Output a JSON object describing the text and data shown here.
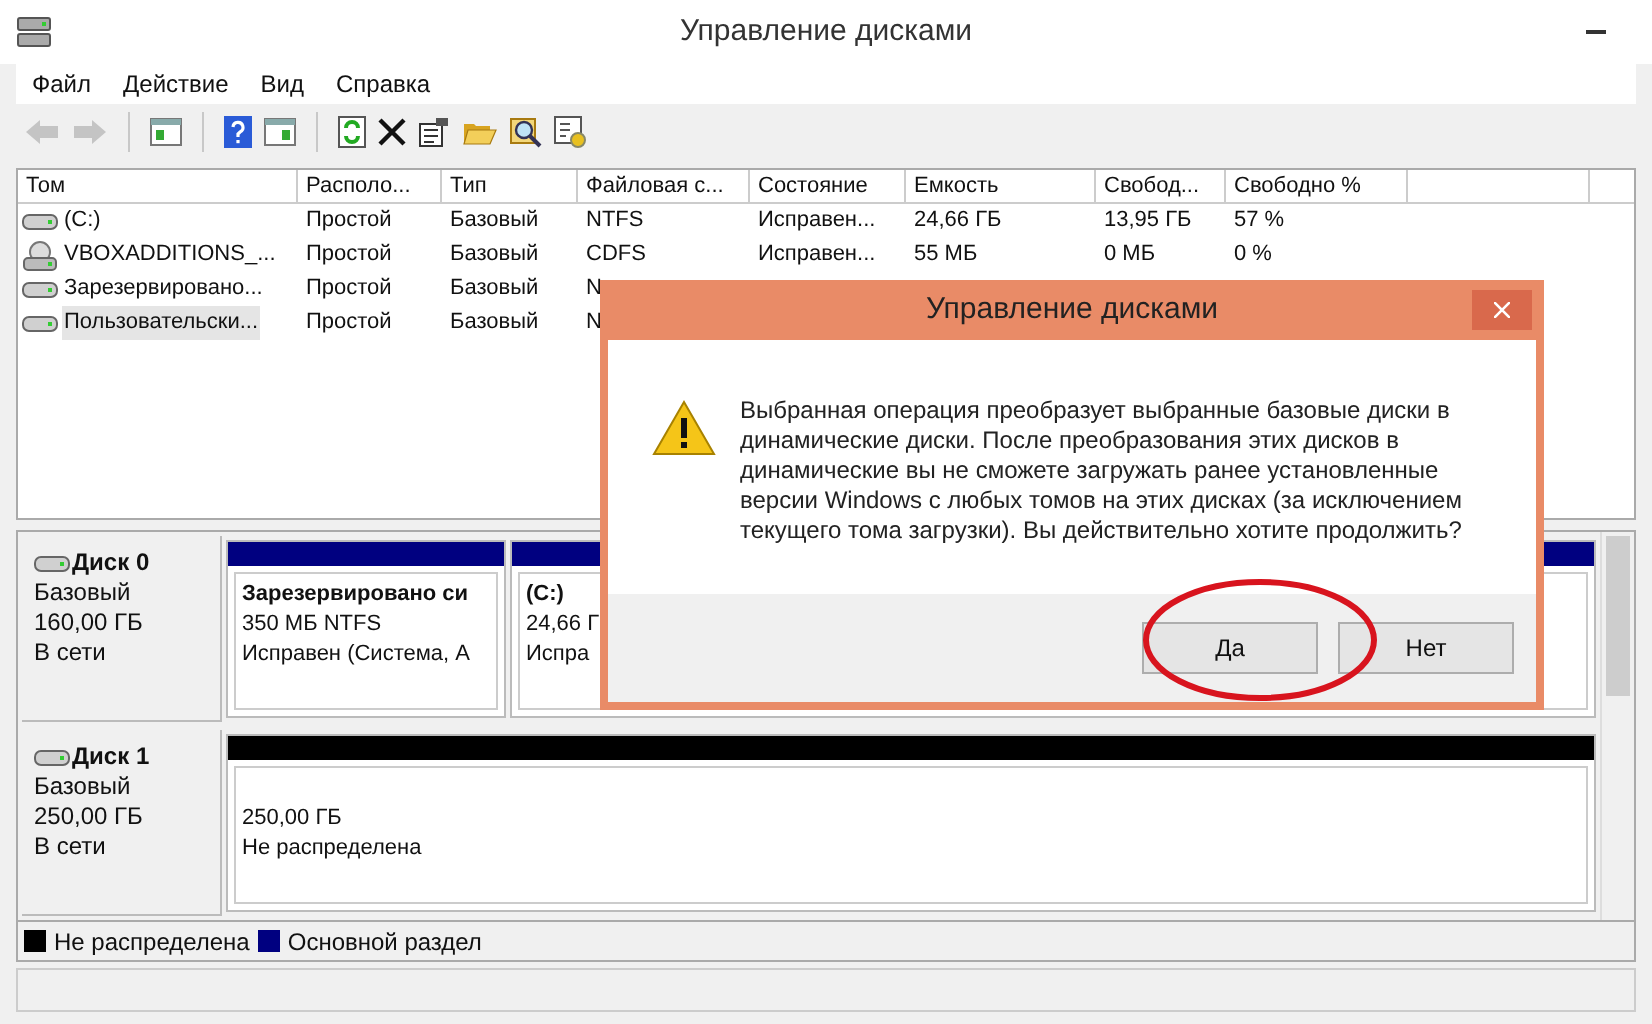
{
  "window": {
    "title": "Управление дисками"
  },
  "menu": [
    "Файл",
    "Действие",
    "Вид",
    "Справка"
  ],
  "toolbar": [
    {
      "kind": "back",
      "disabled": true
    },
    {
      "kind": "forward",
      "disabled": true
    },
    {
      "kind": "sep",
      "disabled": false
    },
    {
      "kind": "panel",
      "disabled": false
    },
    {
      "kind": "sep",
      "disabled": false
    },
    {
      "kind": "help",
      "disabled": false
    },
    {
      "kind": "panel2",
      "disabled": false
    },
    {
      "kind": "sep",
      "disabled": false
    },
    {
      "kind": "refresh",
      "disabled": false
    },
    {
      "kind": "delete",
      "disabled": false
    },
    {
      "kind": "props",
      "disabled": false
    },
    {
      "kind": "open",
      "disabled": false
    },
    {
      "kind": "search",
      "disabled": false
    },
    {
      "kind": "settings",
      "disabled": false
    }
  ],
  "volumes": {
    "columns": [
      "Том",
      "Располо...",
      "Тип",
      "Файловая с...",
      "Состояние",
      "Емкость",
      "Свобод...",
      "Свободно %"
    ],
    "rows": [
      {
        "kind": "drive",
        "selected": false,
        "cells": [
          "(C:)",
          "Простой",
          "Базовый",
          "NTFS",
          "Исправен...",
          "24,66 ГБ",
          "13,95 ГБ",
          "57 %"
        ]
      },
      {
        "kind": "cd",
        "selected": false,
        "cells": [
          "VBOXADDITIONS_...",
          "Простой",
          "Базовый",
          "CDFS",
          "Исправен...",
          "55 МБ",
          "0 МБ",
          "0 %"
        ]
      },
      {
        "kind": "drive",
        "selected": false,
        "cells": [
          "Зарезервировано...",
          "Простой",
          "Базовый",
          "N"
        ]
      },
      {
        "kind": "drive",
        "selected": true,
        "cells": [
          "Пользовательски...",
          "Простой",
          "Базовый",
          "N"
        ]
      }
    ]
  },
  "disks": [
    {
      "name": "Диск 0",
      "type": "Базовый",
      "size": "160,00 ГБ",
      "status": "В сети",
      "partitions": [
        {
          "color": "#000080",
          "title": "Зарезервировано си",
          "lines": [
            "350 МБ NTFS",
            "Исправен (Система, А"
          ]
        },
        {
          "color": "#000080",
          "title": "(C:)",
          "lines": [
            "24,66 Г",
            "Испра"
          ]
        }
      ]
    },
    {
      "name": "Диск 1",
      "type": "Базовый",
      "size": "250,00 ГБ",
      "status": "В сети",
      "partitions": [
        {
          "color": "#000000",
          "lines": [
            "250,00 ГБ",
            "Не распределена"
          ]
        }
      ]
    }
  ],
  "legend": [
    {
      "label": "Не распределена",
      "color": "#000000"
    },
    {
      "label": "Основной раздел",
      "color": "#000080"
    }
  ],
  "dialog": {
    "title": "Управление дисками",
    "message": [
      "Выбранная операция преобразует выбранные базовые диски в",
      "динамические диски. После преобразования этих дисков в",
      "динамические вы не сможете загружать ранее установленные",
      "версии Windows с любых томов на этих дисках (за исключением",
      "текущего тома загрузки). Вы действительно хотите продолжить?"
    ],
    "buttons": [
      "Да",
      "Нет"
    ]
  }
}
